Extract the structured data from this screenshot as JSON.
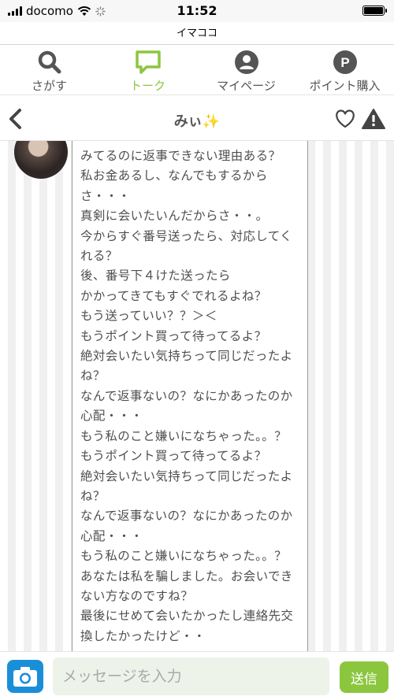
{
  "status_bar": {
    "carrier": "docomo",
    "time": "11:52",
    "battery_level": 1.0
  },
  "app": {
    "title": "イマココ"
  },
  "tabs": [
    {
      "label": "さがす",
      "icon": "search-icon"
    },
    {
      "label": "トーク",
      "icon": "chat-bubble-icon",
      "active": true
    },
    {
      "label": "マイページ",
      "icon": "user-icon"
    },
    {
      "label": "ポイント購入",
      "icon": "point-icon"
    }
  ],
  "header": {
    "title": "みぃ✨"
  },
  "message": {
    "lines": [
      "みてるのに返事できない理由ある？",
      "私お金あるし、なんでもするから",
      "さ・・・",
      "真剣に会いたいんだからさ・・。",
      "今からすぐ番号送ったら、対応してく",
      "れる？",
      "後、番号下４けた送ったら",
      "かかってきてもすぐでれるよね？",
      "もう送っていい？？＞＜",
      "もうポイント買って待ってるよ？",
      "絶対会いたい気持ちって同じだったよ",
      "ね？",
      "なんで返事ないの？なにかあったのか",
      "心配・・・",
      "もう私のこと嫌いになちゃった。。？",
      "もうポイント買って待ってるよ？",
      "絶対会いたい気持ちって同じだったよ",
      "ね？",
      "なんで返事ないの？なにかあったのか",
      "心配・・・",
      "もう私のこと嫌いになちゃった。。？",
      "あなたは私を騙しました。お会いでき",
      "ない方なのですね？",
      "最後にせめて会いたかったし連絡先交",
      "換したかったけど・・"
    ]
  },
  "composer": {
    "placeholder": "メッセージを入力",
    "send_label": "送信"
  },
  "colors": {
    "accent": "#8cc63f",
    "camera": "#1a8fd8"
  }
}
